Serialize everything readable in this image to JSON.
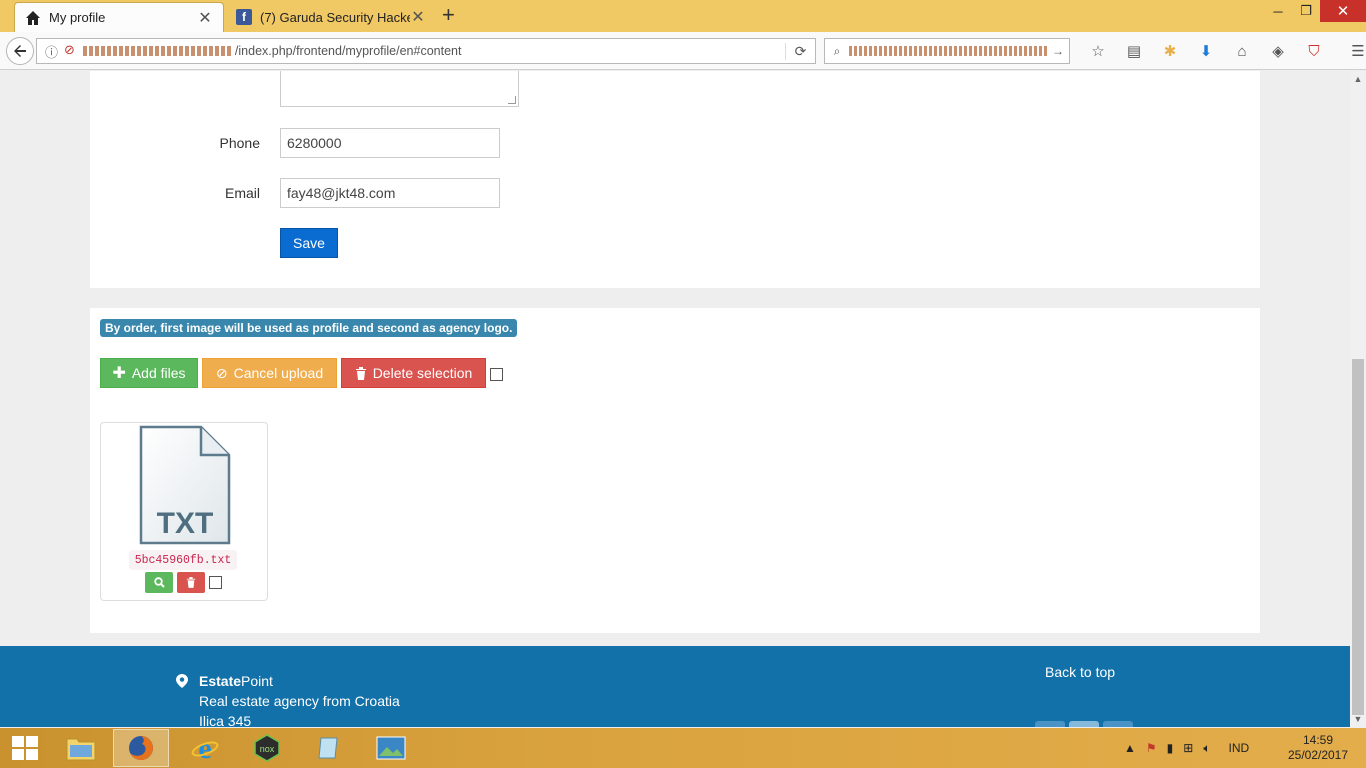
{
  "browser": {
    "tabs": [
      {
        "title": "My profile",
        "icon": "home-icon",
        "active": true
      },
      {
        "title": "(7) Garuda Security Hacker",
        "icon": "facebook-icon",
        "active": false
      }
    ],
    "new_tab": "+",
    "url": "/index.php/frontend/myprofile/en#content",
    "window_controls": {
      "minimize": "─",
      "maximize": "❐",
      "close": "✕"
    }
  },
  "form": {
    "phone_label": "Phone",
    "phone_value": "6280000",
    "email_label": "Email",
    "email_value": "fay48@jkt48.com",
    "save_label": "Save"
  },
  "upload": {
    "info": "By order, first image will be used as profile and second as agency logo.",
    "add_files": "Add files",
    "cancel_upload": "Cancel upload",
    "delete_selection": "Delete selection",
    "file": {
      "type_label": "TXT",
      "name": "5bc45960fb.txt"
    }
  },
  "footer": {
    "brand_bold": "Estate",
    "brand_rest": "Point",
    "tagline": "Real estate agency from Croatia",
    "address": "Ilica 345",
    "back_to_top": "Back to top"
  },
  "taskbar": {
    "language": "IND",
    "time": "14:59",
    "date": "25/02/2017"
  },
  "colors": {
    "primary": "#0a6bd0",
    "success": "#5cb85c",
    "warning": "#f0ad4e",
    "danger": "#d9534f",
    "info": "#3a87ad",
    "footer": "#1271a9",
    "tabbar": "#f0c864"
  }
}
